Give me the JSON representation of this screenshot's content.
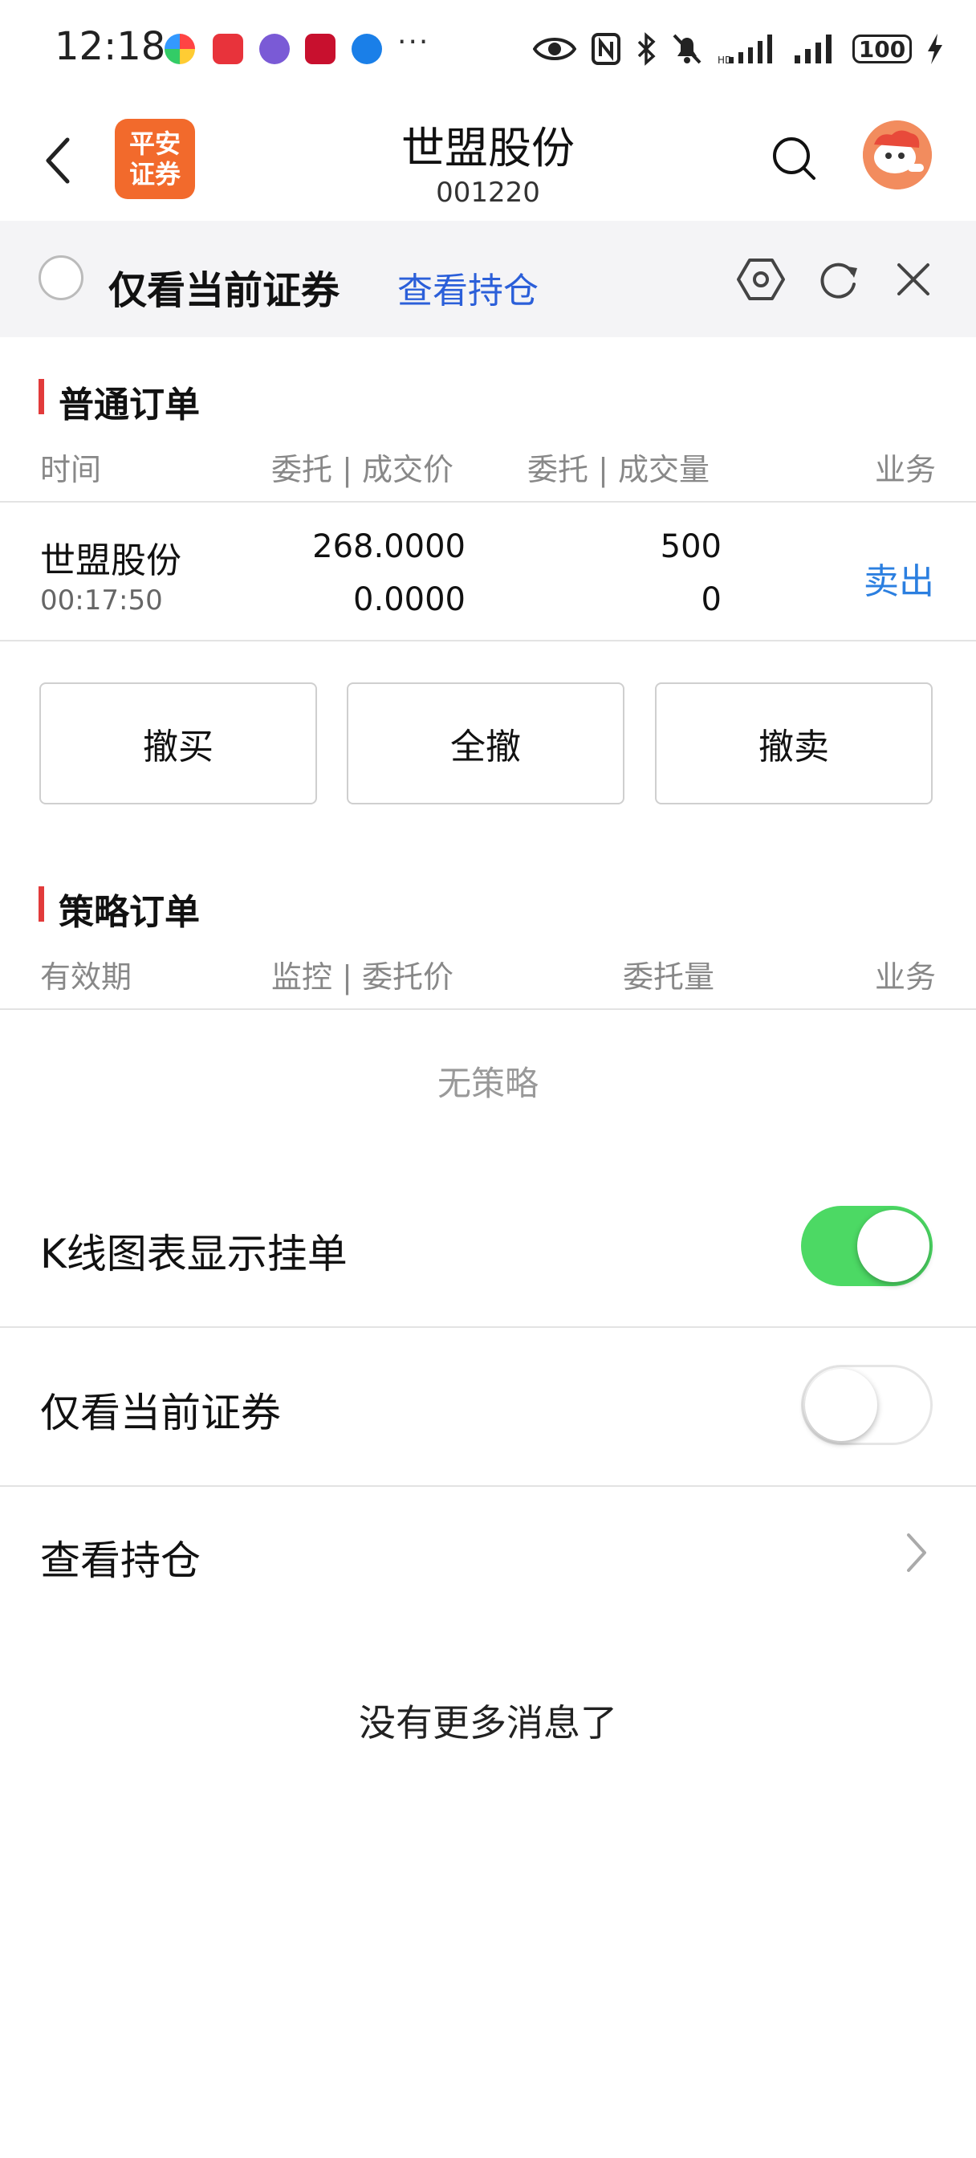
{
  "status_bar": {
    "time": "12:18",
    "more": "···",
    "battery": "100"
  },
  "header": {
    "logo_line1": "平安",
    "logo_line2": "证券",
    "title": "世盟股份",
    "code": "001220",
    "icons": [
      "back-icon",
      "search-icon",
      "avatar"
    ]
  },
  "filter_bar": {
    "only_current_label": "仅看当前证券",
    "view_holdings_link": "查看持仓",
    "icons": [
      "hexagon-settings-icon",
      "refresh-icon",
      "close-icon"
    ]
  },
  "normal_orders": {
    "title": "普通订单",
    "columns": [
      "时间",
      "委托 | 成交价",
      "委托 | 成交量",
      "业务"
    ],
    "rows": [
      {
        "name": "世盟股份",
        "time": "00:17:50",
        "order_price": "268.0000",
        "deal_price": "0.0000",
        "order_qty": "500",
        "deal_qty": "0",
        "action": "卖出"
      }
    ],
    "buttons": [
      "撤买",
      "全撤",
      "撤卖"
    ]
  },
  "strategy_orders": {
    "title": "策略订单",
    "columns": [
      "有效期",
      "监控 | 委托价",
      "委托量",
      "业务"
    ],
    "empty_text": "无策略"
  },
  "settings": {
    "kline_label": "K线图表显示挂单",
    "kline_on": true,
    "only_current_label": "仅看当前证券",
    "only_current_on": false,
    "view_holdings_label": "查看持仓"
  },
  "footer": {
    "no_more": "没有更多消息了"
  },
  "colors": {
    "accent_blue": "#2b5fd9",
    "sell_blue": "#2b7fe0",
    "section_red": "#e23b3b",
    "toggle_green": "#4cd964",
    "logo_orange": "#f26a2c"
  }
}
